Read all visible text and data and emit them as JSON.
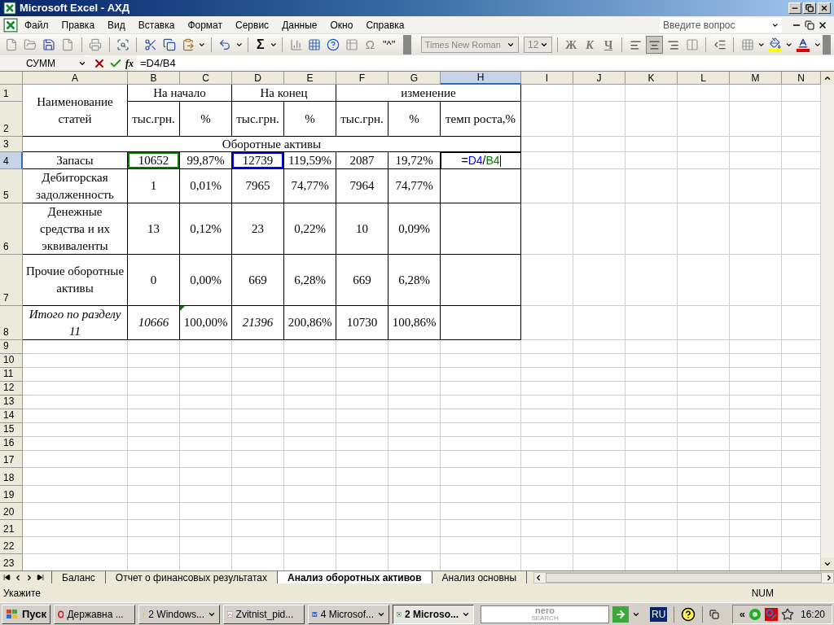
{
  "window": {
    "title": "Microsoft Excel - АХД"
  },
  "menu": [
    "Файл",
    "Правка",
    "Вид",
    "Вставка",
    "Формат",
    "Сервис",
    "Данные",
    "Окно",
    "Справка"
  ],
  "help_box": {
    "placeholder": "Введите вопрос"
  },
  "standard_toolbar": {
    "autosum": "Σ",
    "symbol": "Ω",
    "special": "\"^\""
  },
  "formatting_toolbar": {
    "font": "Times New Roman",
    "size": "12",
    "bold": "Ж",
    "italic": "К",
    "underline": "Ч",
    "alignment": [
      {
        "kind": "left",
        "selected": false
      },
      {
        "kind": "center",
        "selected": true
      },
      {
        "kind": "right",
        "selected": false
      }
    ]
  },
  "formula_bar": {
    "name_box": "СУММ",
    "fx": "fx",
    "formula": "=D4/B4"
  },
  "sheet": {
    "columns": [
      {
        "label": "A",
        "selected": false
      },
      {
        "label": "B",
        "selected": false
      },
      {
        "label": "C",
        "selected": false
      },
      {
        "label": "D",
        "selected": false
      },
      {
        "label": "E",
        "selected": false
      },
      {
        "label": "F",
        "selected": false
      },
      {
        "label": "G",
        "selected": false
      },
      {
        "label": "H",
        "selected": true
      },
      {
        "label": "I",
        "selected": false
      },
      {
        "label": "J",
        "selected": false
      },
      {
        "label": "K",
        "selected": false
      },
      {
        "label": "L",
        "selected": false
      },
      {
        "label": "M",
        "selected": false
      },
      {
        "label": "N",
        "selected": false
      }
    ],
    "row_numbers": [
      {
        "label": "1",
        "selected": false
      },
      {
        "label": "2",
        "selected": false
      },
      {
        "label": "3",
        "selected": false
      },
      {
        "label": "4",
        "selected": true
      },
      {
        "label": "5",
        "selected": false
      },
      {
        "label": "6",
        "selected": false
      },
      {
        "label": "7",
        "selected": false
      },
      {
        "label": "8",
        "selected": false
      },
      {
        "label": "9",
        "selected": false
      },
      {
        "label": "10",
        "selected": false
      },
      {
        "label": "11",
        "selected": false
      },
      {
        "label": "12",
        "selected": false
      },
      {
        "label": "13",
        "selected": false
      },
      {
        "label": "14",
        "selected": false
      },
      {
        "label": "15",
        "selected": false
      },
      {
        "label": "16",
        "selected": false
      },
      {
        "label": "17",
        "selected": false
      },
      {
        "label": "18",
        "selected": false
      },
      {
        "label": "19",
        "selected": false
      },
      {
        "label": "20",
        "selected": false
      },
      {
        "label": "21",
        "selected": false
      },
      {
        "label": "22",
        "selected": false
      },
      {
        "label": "23",
        "selected": false
      }
    ],
    "table": {
      "title_cell": "Наименование статей",
      "groups": [
        "На начало",
        "На конец",
        "изменение"
      ],
      "subheaders": [
        "тыс.грн.",
        "%",
        "тыс.грн.",
        "%",
        "тыс.грн.",
        "%",
        "темп роста,%"
      ],
      "section": "Оборотные активы",
      "rows": [
        {
          "name": "Запасы",
          "values": [
            {
              "text": "10652",
              "color": "#008000"
            },
            {
              "text": "99,87%"
            },
            {
              "text": "12739",
              "color": "#0000ff"
            },
            {
              "text": "119,59%"
            },
            {
              "text": "2087"
            },
            {
              "text": "19,72%"
            }
          ],
          "editing": [
            {
              "text": "=",
              "color": "#000000"
            },
            {
              "text": "D4",
              "color": "#0000ff"
            },
            {
              "text": "/",
              "color": "#000000"
            },
            {
              "text": "B4",
              "color": "#008000"
            }
          ]
        },
        {
          "name": "Дебиторская задолженность",
          "values": [
            {
              "text": "1"
            },
            {
              "text": "0,01%"
            },
            {
              "text": "7965"
            },
            {
              "text": "74,77%"
            },
            {
              "text": "7964"
            },
            {
              "text": "74,77%"
            }
          ]
        },
        {
          "name": "Денежные средства и их эквиваленты",
          "values": [
            {
              "text": "13"
            },
            {
              "text": "0,12%"
            },
            {
              "text": "23"
            },
            {
              "text": "0,22%"
            },
            {
              "text": "10"
            },
            {
              "text": "0,09%"
            }
          ]
        },
        {
          "name": "Прочие оборотные активы",
          "values": [
            {
              "text": "0"
            },
            {
              "text": "0,00%"
            },
            {
              "text": "669"
            },
            {
              "text": "6,28%"
            },
            {
              "text": "669"
            },
            {
              "text": "6,28%"
            }
          ]
        },
        {
          "name": "Итого по разделу 11",
          "name_italic": true,
          "values": [
            {
              "text": "10666",
              "italic": true
            },
            {
              "text": "100,00%",
              "error_flag": true
            },
            {
              "text": "21396",
              "italic": true
            },
            {
              "text": "200,86%"
            },
            {
              "text": "10730"
            },
            {
              "text": "100,86%"
            }
          ]
        }
      ]
    }
  },
  "sheet_tabs": [
    {
      "label": "Баланс",
      "selected": false
    },
    {
      "label": "Отчет о финансовых результатах",
      "selected": false
    },
    {
      "label": "Анализ оборотных активов",
      "selected": true
    },
    {
      "label": "Анализ основны",
      "selected": false
    }
  ],
  "status_bar": {
    "mode": "Укажите",
    "indicator": "NUM"
  },
  "taskbar": {
    "start": "Пуск",
    "tasks": [
      {
        "kind": "opera",
        "label": "Державна ...",
        "menu": false,
        "selected": false
      },
      {
        "kind": "folder",
        "label": "2 Windows...",
        "menu": true,
        "selected": false
      },
      {
        "kind": "pdf",
        "label": "Zvitnist_pid...",
        "menu": false,
        "selected": false
      },
      {
        "kind": "word",
        "label": "4 Microsof...",
        "menu": true,
        "selected": false
      },
      {
        "kind": "excel",
        "label": "2 Microso...",
        "menu": true,
        "selected": true
      }
    ],
    "search_brand": "nero",
    "search_sub": "SEARCH",
    "language": "RU",
    "tray_expand": "«",
    "clock": "16:20"
  }
}
